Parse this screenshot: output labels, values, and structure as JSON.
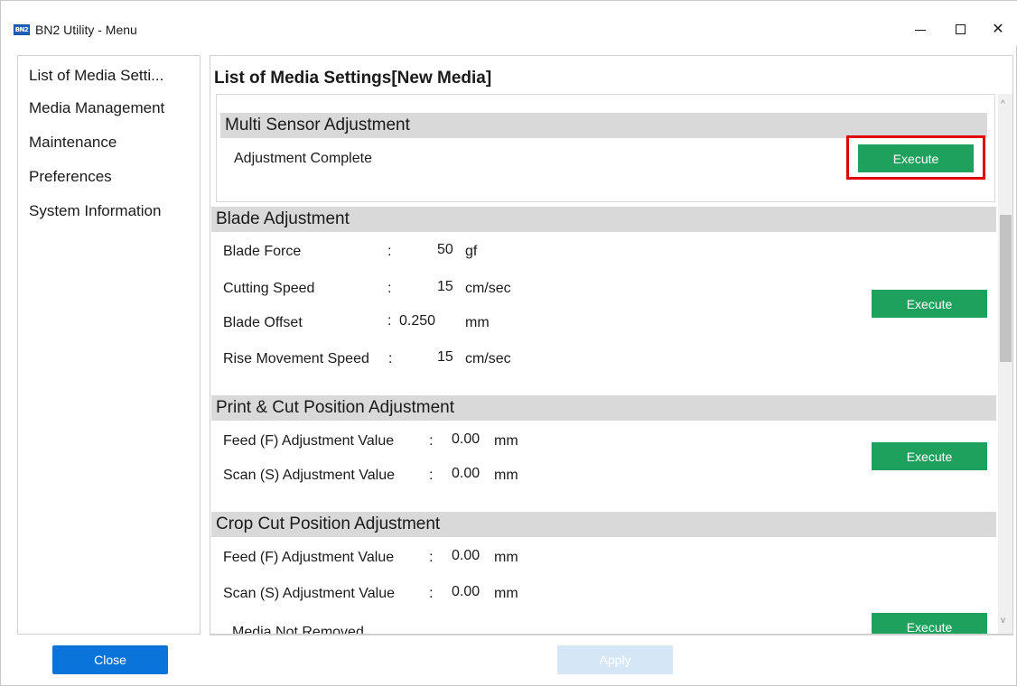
{
  "window": {
    "icon_text": "BN2",
    "title": "BN2 Utility - Menu",
    "minimize_icon": "minimize-icon",
    "maximize_icon": "maximize-icon",
    "close_glyph": "✕"
  },
  "sidebar": {
    "items": [
      {
        "label": "List of Media Setti..."
      },
      {
        "label": "Media Management"
      },
      {
        "label": "Maintenance"
      },
      {
        "label": "Preferences"
      },
      {
        "label": "System Information"
      }
    ],
    "close_label": "Close"
  },
  "main": {
    "title": "List of Media Settings[New Media]",
    "multi_sensor": {
      "header": "Multi Sensor Adjustment",
      "status": "Adjustment Complete",
      "execute_label": "Execute"
    },
    "blade": {
      "header": "Blade Adjustment",
      "rows": [
        {
          "label": "Blade Force",
          "colon": ":",
          "value": "50",
          "unit": "gf"
        },
        {
          "label": "Cutting Speed",
          "colon": ":",
          "value": "15",
          "unit": "cm/sec"
        },
        {
          "label": "Blade Offset",
          "colon": ":",
          "value": "0.250",
          "unit": "mm"
        },
        {
          "label": "Rise Movement Speed",
          "colon": ":",
          "value": "15",
          "unit": "cm/sec"
        }
      ],
      "execute_label": "Execute"
    },
    "print_cut": {
      "header": "Print & Cut Position Adjustment",
      "rows": [
        {
          "label": "Feed (F) Adjustment Value",
          "colon": ":",
          "value": "0.00",
          "unit": "mm"
        },
        {
          "label": "Scan (S) Adjustment Value",
          "colon": ":",
          "value": "0.00",
          "unit": "mm"
        }
      ],
      "execute_label": "Execute"
    },
    "crop_cut": {
      "header": "Crop Cut Position Adjustment",
      "rows": [
        {
          "label": "Feed (F) Adjustment Value",
          "colon": ":",
          "value": "0.00",
          "unit": "mm"
        },
        {
          "label": "Scan (S) Adjustment Value",
          "colon": ":",
          "value": "0.00",
          "unit": "mm"
        }
      ],
      "status": "Media Not Removed",
      "execute_label": "Execute"
    },
    "apply_label": "Apply",
    "scroll_up_glyph": "^",
    "scroll_down_glyph": "v"
  }
}
